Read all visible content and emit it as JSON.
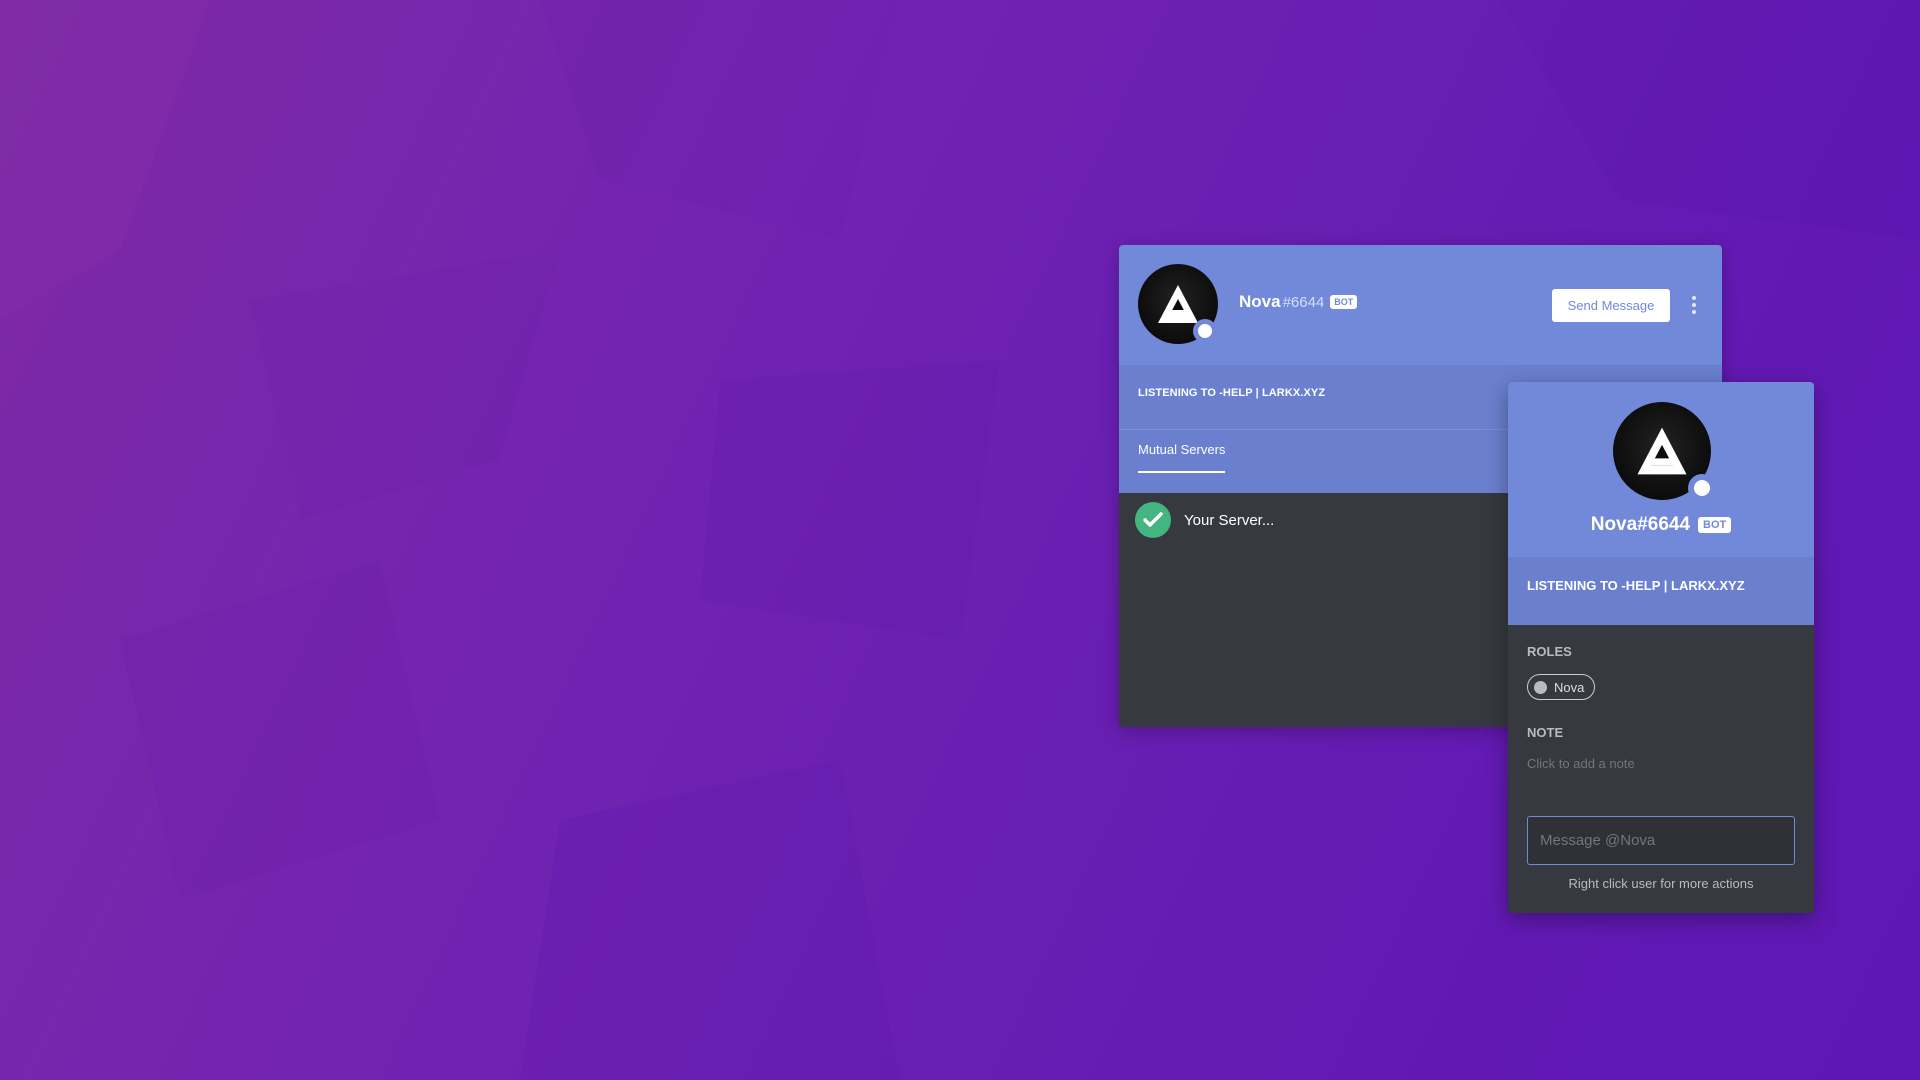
{
  "profile_modal": {
    "username": "Nova",
    "discriminator": "#6644",
    "bot_tag": "BOT",
    "send_message_label": "Send Message",
    "activity": "LISTENING TO -HELP | LARKX.XYZ",
    "tabs": [
      {
        "label": "Mutual Servers",
        "active": true
      }
    ],
    "mutual_servers": [
      {
        "name": "Your Server...",
        "icon": "check-icon"
      }
    ]
  },
  "user_popout": {
    "username_full": "Nova#6644",
    "bot_tag": "BOT",
    "activity": "LISTENING TO -HELP | LARKX.XYZ",
    "roles_label": "ROLES",
    "roles": [
      {
        "name": "Nova"
      }
    ],
    "note_label": "NOTE",
    "note_placeholder": "Click to add a note",
    "message_placeholder": "Message @Nova",
    "hint": "Right click user for more actions"
  },
  "colors": {
    "blurple": "#7289da",
    "dark_bg": "#36393f",
    "online": "#ffffff",
    "check_green": "#43b581"
  }
}
